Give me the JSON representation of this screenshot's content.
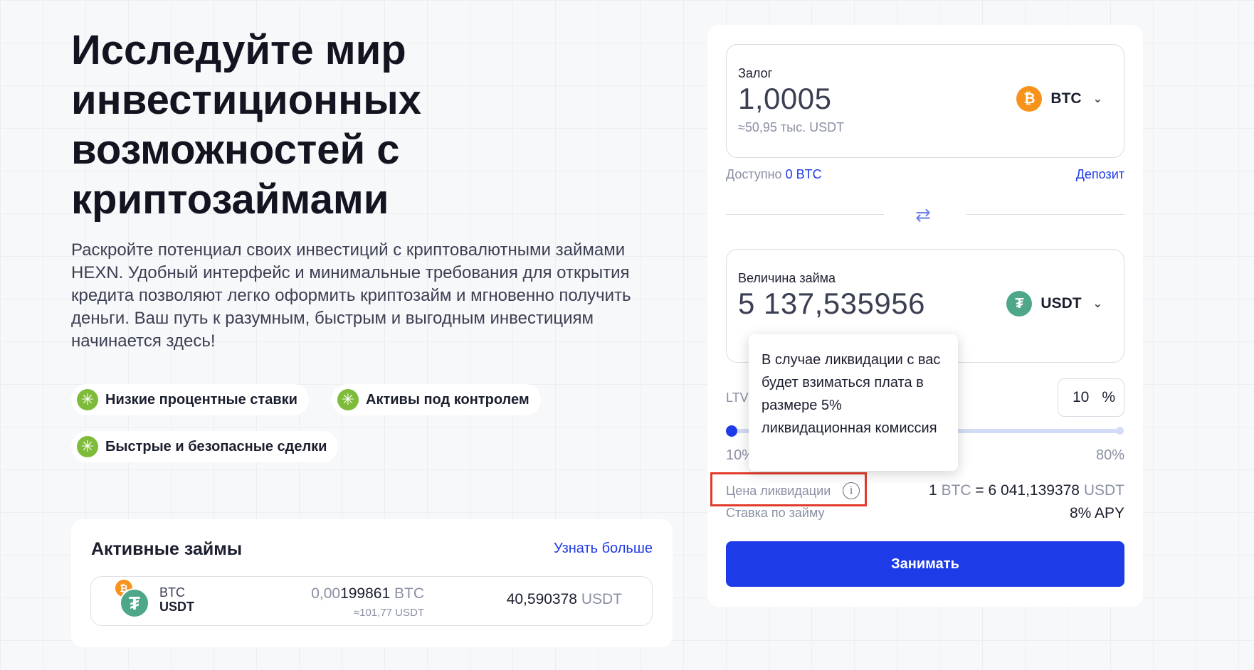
{
  "hero": {
    "title": "Исследуйте мир инвестиционных возможностей с криптозаймами",
    "description": "Раскройте потенциал своих инвестиций с криптовалютными займами HEXN. Удобный интерфейс и минимальные требования для открытия кредита позволяют легко оформить криптозайм и мгновенно получить деньги. Ваш путь к разумным, быстрым и выгодным инвестициям начинается здесь!"
  },
  "features": [
    {
      "label": "Низкие процентные ставки"
    },
    {
      "label": "Активы под контролем"
    },
    {
      "label": "Быстрые и безопасные сделки"
    }
  ],
  "active_loans": {
    "title": "Активные займы",
    "link": "Узнать больше",
    "rows": [
      {
        "base": "BTC",
        "quote": "USDT",
        "collateral_amount_muted": "0,00",
        "collateral_amount": "199861",
        "collateral_unit": "BTC",
        "collateral_usdt": "≈101,77 USDT",
        "loan_amount": "40,590378",
        "loan_unit": "USDT"
      }
    ]
  },
  "form": {
    "collateral": {
      "label": "Залог",
      "value": "1,0005",
      "approx": "≈50,95 тыс. USDT",
      "asset": "BTC"
    },
    "available_label": "Доступно",
    "available_value": "0 BTC",
    "deposit_link": "Депозит",
    "loan": {
      "label": "Величина займа",
      "value": "5 137,535956",
      "asset": "USDT"
    },
    "ltv": {
      "label": "LTV",
      "value": "10",
      "unit": "%",
      "min_label": "10%",
      "max_label": "80%",
      "level": 0
    },
    "liquidation": {
      "label": "Цена ликвидации",
      "lhs": "1",
      "lhs_unit": "BTC",
      "eq": "=",
      "rhs": "6 041,139378",
      "rhs_unit": "USDT"
    },
    "rate": {
      "label": "Ставка по займу",
      "value": "8% APY"
    },
    "submit": "Занимать"
  },
  "tooltip": {
    "text": "В случае ликвидации с вас будет взиматься плата в размере 5% ликвидационная комиссия"
  },
  "colors": {
    "accent": "#1e3be8",
    "btc": "#f7931a",
    "usdt": "#4ea789",
    "check": "#7fbb3b",
    "highlight": "#e23b2b"
  },
  "icons": {
    "btc": "bitcoin-icon",
    "usdt": "tether-icon",
    "swap": "swap-icon",
    "info": "info-icon",
    "chevron": "chevron-down-icon",
    "check": "check-icon"
  }
}
